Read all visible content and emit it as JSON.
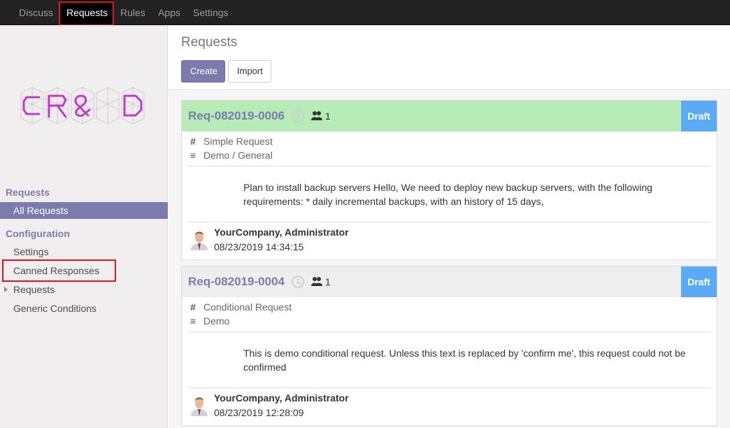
{
  "topbar": {
    "items": [
      {
        "label": "Discuss"
      },
      {
        "label": "Requests"
      },
      {
        "label": "Rules"
      },
      {
        "label": "Apps"
      },
      {
        "label": "Settings"
      }
    ]
  },
  "sidebar": {
    "logo_text": "CR&D",
    "section_requests": "Requests",
    "all_requests": "All Requests",
    "section_configuration": "Configuration",
    "settings": "Settings",
    "canned_responses": "Canned Responses",
    "requests_sub": "Requests",
    "generic_conditions": "Generic Conditions"
  },
  "control": {
    "title": "Requests",
    "create_label": "Create",
    "import_label": "Import"
  },
  "requests": [
    {
      "name": "Req-082019-0006",
      "followers": "1",
      "stage": "Draft",
      "type": "Simple Request",
      "category": "Demo / General",
      "description": "Plan to install backup servers Hello, We need to deploy new backup servers, with the following requirements: * daily incremental backups, with an history of 15 days,",
      "author": "YourCompany, Administrator",
      "date": "08/23/2019 14:34:15",
      "header_color": "#b7ebb7"
    },
    {
      "name": "Req-082019-0004",
      "followers": "1",
      "stage": "Draft",
      "type": "Conditional Request",
      "category": "Demo",
      "description": "This is demo conditional request. Unless this text is replaced by 'confirm me', this request could not be confirmed",
      "author": "YourCompany, Administrator",
      "date": "08/23/2019 12:28:09",
      "header_color": "#eeeeee"
    }
  ],
  "colors": {
    "brand": "#7c7bad",
    "badge": "#5aaaf5",
    "highlight": "#e0161d"
  }
}
